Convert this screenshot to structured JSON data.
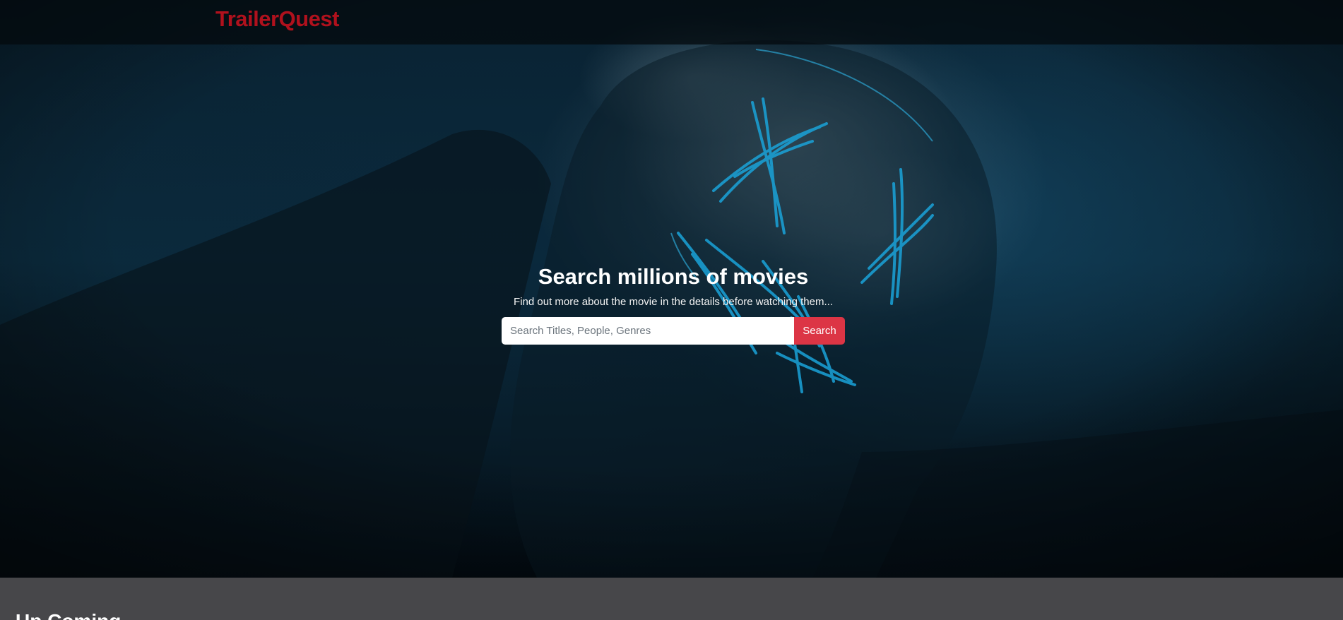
{
  "navbar": {
    "brand": "TrailerQuest"
  },
  "hero": {
    "headline": "Search millions of movies",
    "subhead": "Find out more about the movie in the details before watching them...",
    "search": {
      "placeholder": "Search Titles, People, Genres",
      "value": "",
      "button_label": "Search"
    }
  },
  "next_section": {
    "heading": "Up Coming"
  },
  "colors": {
    "brand": "#b0111d",
    "button": "#dc3545",
    "section_bg": "#47474a",
    "neon": "#1aa3d9"
  }
}
